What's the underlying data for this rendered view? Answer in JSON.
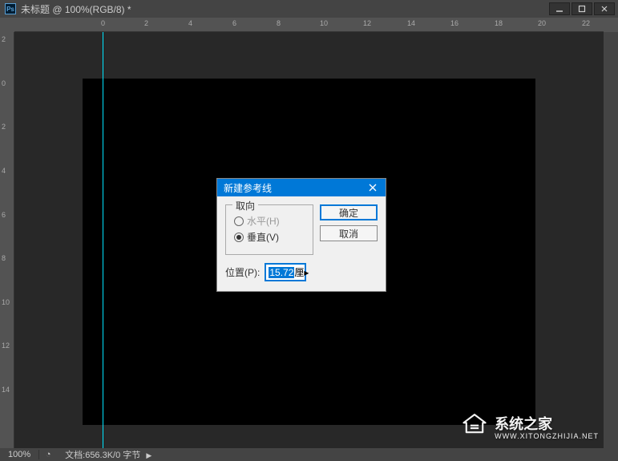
{
  "titlebar": {
    "app_icon_text": "Ps",
    "title": "未标题 @ 100%(RGB/8) *"
  },
  "ruler_h": [
    "0",
    "2",
    "4",
    "6",
    "8",
    "10",
    "12",
    "14",
    "16",
    "18",
    "20",
    "22"
  ],
  "ruler_v": [
    "2",
    "0",
    "2",
    "4",
    "6",
    "8",
    "10",
    "12",
    "14"
  ],
  "dialog": {
    "title": "新建参考线",
    "orientation_label": "取向",
    "radio_horizontal": "水平(H)",
    "radio_vertical": "垂直(V)",
    "ok": "确定",
    "cancel": "取消",
    "position_label": "位置(P):",
    "position_value": "15.72",
    "position_unit": "厘"
  },
  "statusbar": {
    "zoom": "100%",
    "doc_info": "文档:656.3K/0 字节"
  },
  "watermark": {
    "brand": "系统之家",
    "url": "WWW.XITONGZHIJIA.NET"
  }
}
